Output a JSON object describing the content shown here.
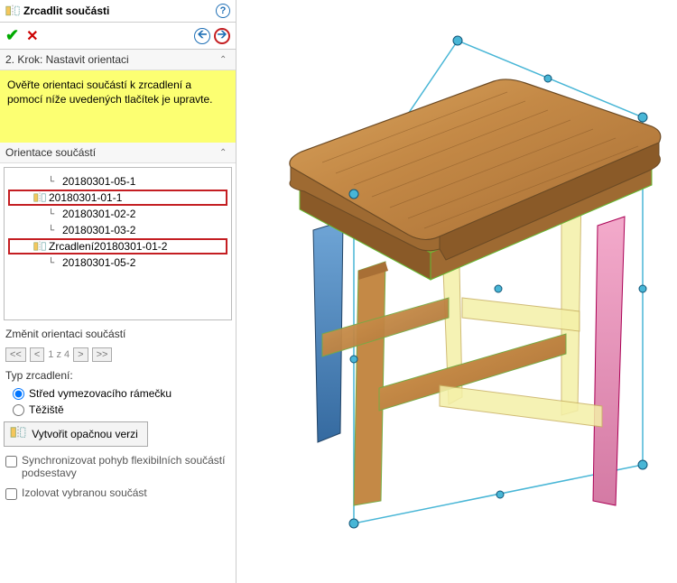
{
  "header": {
    "title": "Zrcadlit součásti"
  },
  "step": {
    "label": "2. Krok: Nastavit orientaci"
  },
  "hint": {
    "text": "Ověřte orientaci součástí k zrcadlení a pomocí níže uvedených tlačítek je upravte."
  },
  "orientation": {
    "label": "Orientace součástí",
    "items": [
      {
        "name": "20180301-05-1",
        "indent": true,
        "highlighted": false,
        "mirror": false
      },
      {
        "name": "20180301-01-1",
        "indent": false,
        "highlighted": true,
        "mirror": true
      },
      {
        "name": "20180301-02-2",
        "indent": true,
        "highlighted": false,
        "mirror": false
      },
      {
        "name": "20180301-03-2",
        "indent": true,
        "highlighted": false,
        "mirror": false
      },
      {
        "name": "Zrcadlení20180301-01-2",
        "indent": false,
        "highlighted": true,
        "mirror": true
      },
      {
        "name": "20180301-05-2",
        "indent": true,
        "highlighted": false,
        "mirror": false
      }
    ]
  },
  "changeOrientation": {
    "label": "Změnit orientaci součástí",
    "pager": "1 z 4"
  },
  "mirrorType": {
    "label": "Typ zrcadlení:",
    "opt1": "Střed vymezovacího rámečku",
    "opt2": "Těžiště"
  },
  "oppositeBtn": {
    "label": "Vytvořit opačnou verzi"
  },
  "syncCheckbox": {
    "label": "Synchronizovat pohyb flexibilních součástí podsestavy"
  },
  "isolateCheckbox": {
    "label": "Izolovat vybranou součást"
  }
}
